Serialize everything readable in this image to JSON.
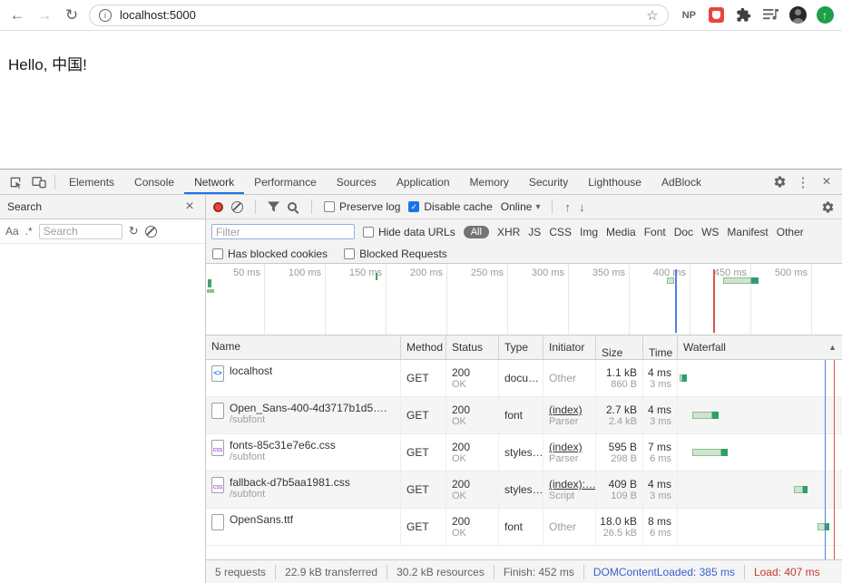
{
  "browser": {
    "url": "localhost:5000",
    "extensions_np": "NP"
  },
  "page": {
    "greeting": "Hello, 中国!"
  },
  "icons": {
    "back": "←",
    "forward": "→",
    "reload": "↻",
    "info": "i",
    "star": "☆",
    "update": "↑",
    "menu": "⋮",
    "close": "×",
    "check": "✓",
    "caret": "▾",
    "sort": "▲",
    "upload": "↑",
    "download": "↓",
    "refresh": "↻",
    "code": "<>",
    "css_label": "css",
    "match_case": "Aa",
    "regex": ".*"
  },
  "colors": {
    "accent_blue": "#1a73e8",
    "record_red": "#df4a3f",
    "dcl_blue": "#4f7fe8",
    "load_red": "#e0504a",
    "waterfall_green": "#2f9e6e"
  },
  "devtools": {
    "tabs": [
      "Elements",
      "Console",
      "Network",
      "Performance",
      "Sources",
      "Application",
      "Memory",
      "Security",
      "Lighthouse",
      "AdBlock"
    ],
    "selected_tab": "Network",
    "search_panel": {
      "title": "Search",
      "input_placeholder": "Search"
    },
    "net_toolbar": {
      "preserve_log": "Preserve log",
      "disable_cache": "Disable cache",
      "throttling": "Online"
    },
    "filter_row": {
      "placeholder": "Filter",
      "hide_data_urls": "Hide data URLs",
      "filters": [
        "All",
        "XHR",
        "JS",
        "CSS",
        "Img",
        "Media",
        "Font",
        "Doc",
        "WS",
        "Manifest",
        "Other"
      ]
    },
    "blocked_row": {
      "has_blocked_cookies": "Has blocked cookies",
      "blocked_requests": "Blocked Requests"
    },
    "timeline": {
      "ticks": [
        "50 ms",
        "100 ms",
        "150 ms",
        "200 ms",
        "250 ms",
        "300 ms",
        "350 ms",
        "400 ms",
        "450 ms",
        "500 ms"
      ]
    },
    "table": {
      "columns": [
        "Name",
        "Method",
        "Status",
        "Type",
        "Initiator",
        "Size",
        "Time",
        "Waterfall"
      ],
      "rows": [
        {
          "name": "localhost",
          "path": "",
          "method": "GET",
          "status": "200",
          "status_text": "OK",
          "type": "docu…",
          "initiator": "Other",
          "initiator_type": "",
          "size": "1.1 kB",
          "size_transferred": "860 B",
          "time": "4 ms",
          "latency": "3 ms"
        },
        {
          "name": "Open_Sans-400-4d3717b1d5….",
          "path": "/subfont",
          "method": "GET",
          "status": "200",
          "status_text": "OK",
          "type": "font",
          "initiator": "(index)",
          "initiator_type": "Parser",
          "size": "2.7 kB",
          "size_transferred": "2.4 kB",
          "time": "4 ms",
          "latency": "3 ms"
        },
        {
          "name": "fonts-85c31e7e6c.css",
          "path": "/subfont",
          "method": "GET",
          "status": "200",
          "status_text": "OK",
          "type": "styles…",
          "initiator": "(index)",
          "initiator_type": "Parser",
          "size": "595 B",
          "size_transferred": "298 B",
          "time": "7 ms",
          "latency": "6 ms"
        },
        {
          "name": "fallback-d7b5aa1981.css",
          "path": "/subfont",
          "method": "GET",
          "status": "200",
          "status_text": "OK",
          "type": "styles…",
          "initiator": "(index):…",
          "initiator_type": "Script",
          "size": "409 B",
          "size_transferred": "109 B",
          "time": "4 ms",
          "latency": "3 ms"
        },
        {
          "name": "OpenSans.ttf",
          "path": "",
          "method": "GET",
          "status": "200",
          "status_text": "OK",
          "type": "font",
          "initiator": "Other",
          "initiator_type": "",
          "size": "18.0 kB",
          "size_transferred": "26.5 kB",
          "time": "8 ms",
          "latency": "6 ms"
        }
      ]
    },
    "status_bar": {
      "requests": "5 requests",
      "transferred": "22.9 kB transferred",
      "resources": "30.2 kB resources",
      "finish": "Finish: 452 ms",
      "dom_content_loaded": "DOMContentLoaded: 385 ms",
      "load": "Load: 407 ms"
    }
  }
}
